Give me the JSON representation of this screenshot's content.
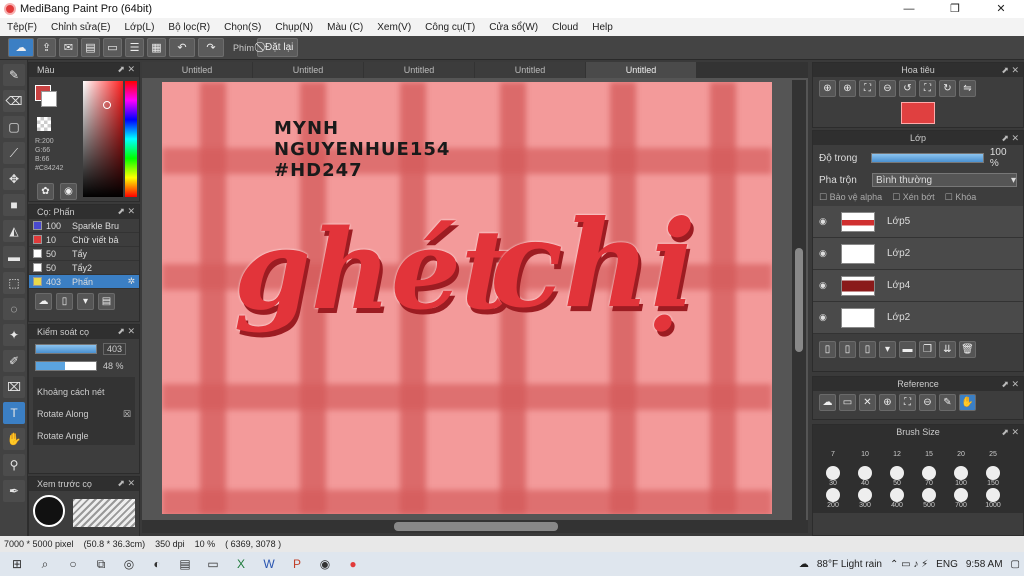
{
  "window": {
    "title": "MediBang Paint Pro (64bit)"
  },
  "menu": [
    "Tệp(F)",
    "Chỉnh sửa(E)",
    "Lớp(L)",
    "Bộ lọc(R)",
    "Chọn(S)",
    "Chụp(N)",
    "Màu (C)",
    "Xem(V)",
    "Công cụ(T)",
    "Cửa sổ(W)",
    "Cloud",
    "Help"
  ],
  "toolbar": {
    "key_label": "Phím",
    "reset_label": "Đặt lại"
  },
  "tabs": [
    "Untitled",
    "Untitled",
    "Untitled",
    "Untitled",
    "Untitled"
  ],
  "color_panel": {
    "title": "Màu",
    "rgb": [
      "R:200",
      "G:66",
      "B:66",
      "#C84242"
    ],
    "primary": "#c84242"
  },
  "brush_panel": {
    "title": "Cọ: Phấn",
    "items": [
      {
        "size": "100",
        "name": "Sparkle Bru",
        "color": "#4a4ad0"
      },
      {
        "size": "10",
        "name": "Chữ viết bả",
        "color": "#e03a3a"
      },
      {
        "size": "50",
        "name": "Tẩy",
        "color": "#ffffff"
      },
      {
        "size": "50",
        "name": "Tẩy2",
        "color": "#ffffff"
      },
      {
        "size": "403",
        "name": "Phấn",
        "color": "#e8d84a"
      }
    ]
  },
  "brush_control": {
    "title": "Kiểm soát cọ",
    "size": "403",
    "opacity": "48 %",
    "options": [
      "Khoảng cách nét",
      "Rotate Along",
      "Rotate Angle"
    ]
  },
  "preview": {
    "title": "Xem trước cọ"
  },
  "canvas": {
    "sig1": "MYNH",
    "sig2": "NGUYENHUE154",
    "sig3": "#HD247",
    "word1": "ghét",
    "word2": "chị"
  },
  "navigator": {
    "title": "Hoa tiêu"
  },
  "layers": {
    "title": "Lớp",
    "opacity_label": "Độ trong",
    "opacity_value": "100 %",
    "blend_label": "Pha trộn",
    "blend_value": "Bình thường",
    "protect_alpha": "Bảo vệ alpha",
    "clipping": "Xén bớt",
    "lock": "Khóa",
    "items": [
      "Lớp5",
      "Lớp2",
      "Lớp4",
      "Lớp2"
    ]
  },
  "reference": {
    "title": "Reference"
  },
  "brush_size": {
    "title": "Brush Size",
    "sizes": [
      "7",
      "10",
      "12",
      "15",
      "20",
      "25",
      "30",
      "40",
      "50",
      "70",
      "100",
      "150",
      "200",
      "300",
      "400",
      "500",
      "700",
      "1000"
    ]
  },
  "status": {
    "dimensions": "7000 * 5000 pixel",
    "cm": "(50.8 * 36.3cm)",
    "dpi": "350 dpi",
    "zoom": "10 %",
    "coords": "( 6369, 3078 )"
  },
  "taskbar": {
    "weather": "88°F  Light rain",
    "lang": "ENG",
    "time": "9:58 AM"
  }
}
